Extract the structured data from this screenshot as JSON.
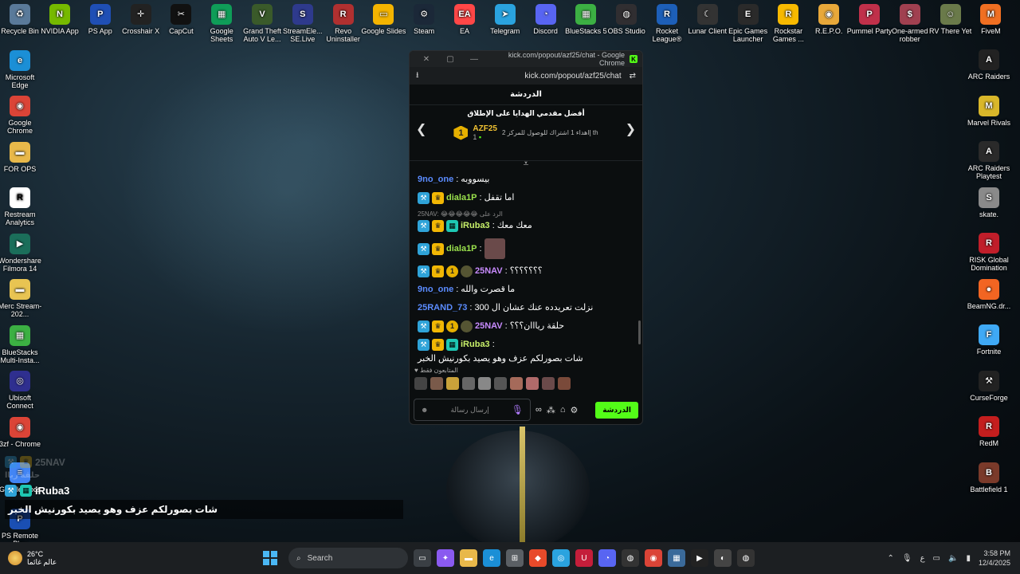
{
  "desktop_left": [
    {
      "label": "Recycle Bin",
      "icon": "recycle-bin-icon",
      "color": "#5a7a9a",
      "glyph": "♻"
    },
    {
      "label": "Microsoft Edge",
      "icon": "edge-icon",
      "color": "#1b8fd6",
      "glyph": "e"
    },
    {
      "label": "Google Chrome",
      "icon": "chrome-icon",
      "color": "#db4437",
      "glyph": "◉"
    },
    {
      "label": "FOR OPS",
      "icon": "folder-icon",
      "color": "#e8b84a",
      "glyph": "▬"
    },
    {
      "label": "Restream Analytics",
      "icon": "restream-icon",
      "color": "#ffffff",
      "glyph": "R"
    },
    {
      "label": "Wondershare Filmora 14",
      "icon": "filmora-icon",
      "color": "#1b6e5a",
      "glyph": "▶"
    },
    {
      "label": "Merc Stream-202...",
      "icon": "folder-icon",
      "color": "#e8c452",
      "glyph": "▬"
    },
    {
      "label": "BlueStacks Multi-Insta...",
      "icon": "bluestacks-icon",
      "color": "#3cb043",
      "glyph": "▦"
    },
    {
      "label": "Ubisoft Connect",
      "icon": "ubisoft-icon",
      "color": "#2f2f8f",
      "glyph": "◎"
    },
    {
      "label": "3zf - Chrome",
      "icon": "chrome-icon",
      "color": "#db4437",
      "glyph": "◉"
    },
    {
      "label": "Google Docs",
      "icon": "google-docs-icon",
      "color": "#4285f4",
      "glyph": "≡"
    },
    {
      "label": "PS Remote Play",
      "icon": "ps-remote-icon",
      "color": "#1a4fb3",
      "glyph": "P"
    }
  ],
  "desktop_top": [
    {
      "label": "NVIDIA App",
      "icon": "nvidia-icon",
      "color": "#76b900",
      "glyph": "N"
    },
    {
      "label": "PS App",
      "icon": "playstation-icon",
      "color": "#1f4fb5",
      "glyph": "P"
    },
    {
      "label": "Crosshair X",
      "icon": "crosshair-icon",
      "color": "#222222",
      "glyph": "✛"
    },
    {
      "label": "CapCut",
      "icon": "capcut-icon",
      "color": "#111111",
      "glyph": "✂"
    },
    {
      "label": "Google Sheets",
      "icon": "google-sheets-icon",
      "color": "#0f9d58",
      "glyph": "▦"
    },
    {
      "label": "Grand Theft Auto V Le...",
      "icon": "gta-icon",
      "color": "#3a5a2a",
      "glyph": "V"
    },
    {
      "label": "StreamEle... SE.Live",
      "icon": "streamelements-icon",
      "color": "#2e3a8c",
      "glyph": "S"
    },
    {
      "label": "Revo Uninstaller",
      "icon": "revo-icon",
      "color": "#b03030",
      "glyph": "R"
    },
    {
      "label": "Google Slides",
      "icon": "google-slides-icon",
      "color": "#f4b400",
      "glyph": "▭"
    },
    {
      "label": "Steam",
      "icon": "steam-icon",
      "color": "#1b2838",
      "glyph": "⚙"
    },
    {
      "label": "EA",
      "icon": "ea-icon",
      "color": "#ff4747",
      "glyph": "EA"
    },
    {
      "label": "Telegram",
      "icon": "telegram-icon",
      "color": "#2aa3df",
      "glyph": "➤"
    },
    {
      "label": "Discord",
      "icon": "discord-icon",
      "color": "#5865f2",
      "glyph": "◔"
    },
    {
      "label": "BlueStacks 5",
      "icon": "bluestacks-icon",
      "color": "#3cb043",
      "glyph": "▦"
    },
    {
      "label": "OBS Studio",
      "icon": "obs-icon",
      "color": "#302e31",
      "glyph": "◍"
    },
    {
      "label": "Rocket League®",
      "icon": "rocket-league-icon",
      "color": "#1d5fb8",
      "glyph": "R"
    },
    {
      "label": "Lunar Client",
      "icon": "lunar-client-icon",
      "color": "#333333",
      "glyph": "☾"
    },
    {
      "label": "Epic Games Launcher",
      "icon": "epic-games-icon",
      "color": "#2a2a2a",
      "glyph": "E"
    },
    {
      "label": "Rockstar Games ...",
      "icon": "rockstar-icon",
      "color": "#f7b900",
      "glyph": "R"
    },
    {
      "label": "R.E.P.O.",
      "icon": "repo-icon",
      "color": "#e8a83a",
      "glyph": "◉"
    },
    {
      "label": "Pummel Party",
      "icon": "pummel-party-icon",
      "color": "#c0304a",
      "glyph": "P"
    },
    {
      "label": "One-armed robber",
      "icon": "robber-icon",
      "color": "#a04050",
      "glyph": "$"
    },
    {
      "label": "RV There Yet",
      "icon": "rv-there-yet-icon",
      "color": "#6a7a4a",
      "glyph": "☺"
    },
    {
      "label": "FiveM",
      "icon": "fivem-icon",
      "color": "#f06f22",
      "glyph": "M"
    }
  ],
  "desktop_right": [
    {
      "label": "ARC Raiders",
      "icon": "arc-raiders-icon",
      "color": "#222222",
      "glyph": "A"
    },
    {
      "label": "Marvel Rivals",
      "icon": "marvel-rivals-icon",
      "color": "#d9b72a",
      "glyph": "M"
    },
    {
      "label": "ARC Raiders Playtest",
      "icon": "arc-raiders-icon",
      "color": "#2a2a2a",
      "glyph": "A"
    },
    {
      "label": "skate.",
      "icon": "skate-icon",
      "color": "#8a8a8a",
      "glyph": "S"
    },
    {
      "label": "RISK Global Domination",
      "icon": "risk-icon",
      "color": "#c01e2a",
      "glyph": "R"
    },
    {
      "label": "BeamNG.dr...",
      "icon": "beamng-icon",
      "color": "#f26522",
      "glyph": "●"
    },
    {
      "label": "Fortnite",
      "icon": "fortnite-icon",
      "color": "#3fa9f5",
      "glyph": "F"
    },
    {
      "label": "CurseForge",
      "icon": "curseforge-icon",
      "color": "#222222",
      "glyph": "⚒"
    },
    {
      "label": "RedM",
      "icon": "redm-icon",
      "color": "#c41e1e",
      "glyph": "R"
    },
    {
      "label": "Battlefield 1",
      "icon": "battlefield-icon",
      "color": "#7a3a2a",
      "glyph": "B"
    }
  ],
  "browser": {
    "title": "kick.com/popout/azf25/chat - Google Chrome",
    "url": "kick.com/popout/azf25/chat"
  },
  "chat": {
    "header": "الدردشة",
    "gifters_title": "أفضل مقدمي الهدايا على الإطلاق",
    "top_gifter": {
      "rank": "1",
      "name": "AZF25",
      "count": "1"
    },
    "next_goal": "إاهداء 1 اشتراك للوصول للمركز 2 th",
    "messages": [
      {
        "user": "9no_one",
        "text": "بيسووبه",
        "color": "#5b8cff",
        "badges": [],
        "reply": ""
      },
      {
        "user": "diala1P",
        "text": "اما تقفل",
        "color": "#9be24d",
        "badges": [
          "mod",
          "vip"
        ],
        "reply": ""
      },
      {
        "user": "iRuba3",
        "text": "معك معك",
        "color": "#c8f06a",
        "badges": [
          "mod",
          "vip",
          "sub"
        ],
        "reply": "25NAV: 😂😂😂😂😂 الرد على"
      },
      {
        "user": "diala1P",
        "text": "",
        "color": "#9be24d",
        "badges": [
          "mod",
          "vip"
        ],
        "reply": ""
      },
      {
        "user": "25NAV",
        "text": "؟؟؟؟؟؟؟",
        "color": "#c88bff",
        "badges": [
          "mod",
          "vip",
          "one",
          "avatar"
        ],
        "reply": ""
      },
      {
        "user": "9no_one",
        "text": "ما قصرت والله",
        "color": "#5b8cff",
        "badges": [],
        "reply": ""
      },
      {
        "user": "25RAND_73",
        "text": "نزلت تعريدده عنك عشان ال 300",
        "color": "#5b8cff",
        "badges": [],
        "reply": ""
      },
      {
        "user": "25NAV",
        "text": "حلقة ريااان؟؟؟",
        "color": "#c88bff",
        "badges": [
          "mod",
          "vip",
          "one",
          "avatar"
        ],
        "reply": ""
      },
      {
        "user": "iRuba3",
        "text": "شات بصورلكم عزف وهو يصيد بكورنيش الخبر",
        "color": "#c8f06a",
        "badges": [
          "mod",
          "vip",
          "sub"
        ],
        "reply": ""
      }
    ],
    "followers_label": "المتابعون فقط",
    "input_placeholder": "إرسال رسالة",
    "chat_button": "الدردشة"
  },
  "overlay": {
    "faded_user": "25NAV",
    "faded_text": "حلقة رياا",
    "user": "iRuba3",
    "message": "شات بصورلكم عزف وهو يصيد بكورنيش الخبر"
  },
  "taskbar": {
    "temp": "26°C",
    "weather_text": "عالم غائما",
    "search_label": "Search",
    "lang": "ع",
    "time": "3:58 PM",
    "date": "12/4/2025"
  }
}
